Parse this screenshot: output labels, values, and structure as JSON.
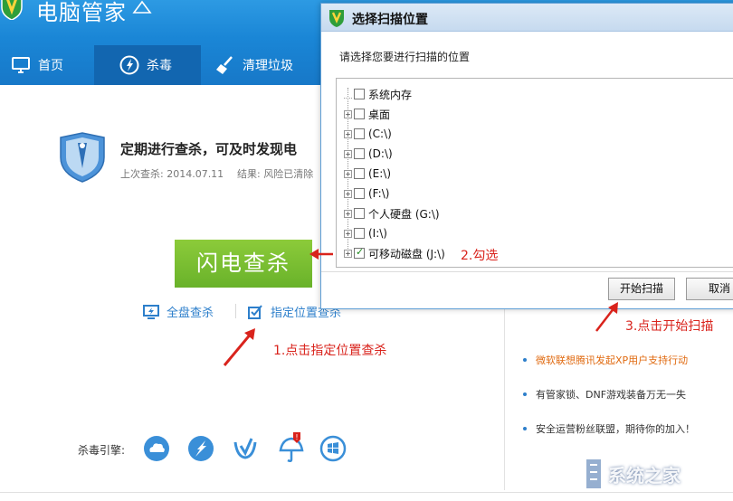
{
  "app": {
    "title": "电脑管家"
  },
  "nav": {
    "items": [
      {
        "label": "首页",
        "icon": "monitor-icon"
      },
      {
        "label": "杀毒",
        "icon": "lightning-icon"
      },
      {
        "label": "清理垃圾",
        "icon": "broom-icon"
      }
    ]
  },
  "main": {
    "heading": "定期进行查杀，可及时发现电",
    "last_scan": "上次查杀: 2014.07.11",
    "result": "结果: 风险已清除",
    "flash_button": "闪电查杀",
    "full_scan": "全盘查杀",
    "custom_scan": "指定位置查杀",
    "engine_label": "杀毒引擎:",
    "engines": [
      "cloud-engine-icon",
      "system-repair-engine-icon",
      "heuristic-engine-icon",
      "umbrella-engine-icon",
      "windows-engine-icon"
    ]
  },
  "news": [
    "微软联想腾讯发起XP用户支持行动",
    "有管家锁、DNF游戏装备万无一失",
    "安全运营粉丝联盟，期待你的加入！"
  ],
  "dialog": {
    "title": "选择扫描位置",
    "prompt": "请选择您要进行扫描的位置",
    "tree": [
      {
        "label": "系统内存",
        "expandable": false,
        "checked": false
      },
      {
        "label": "桌面",
        "expandable": true,
        "checked": false
      },
      {
        "label": "(C:\\)",
        "expandable": true,
        "checked": false
      },
      {
        "label": "(D:\\)",
        "expandable": true,
        "checked": false
      },
      {
        "label": "(E:\\)",
        "expandable": true,
        "checked": false
      },
      {
        "label": "(F:\\)",
        "expandable": true,
        "checked": false
      },
      {
        "label": "个人硬盘 (G:\\)",
        "expandable": true,
        "checked": false
      },
      {
        "label": "(I:\\)",
        "expandable": true,
        "checked": false
      },
      {
        "label": "可移动磁盘 (J:\\)",
        "expandable": true,
        "checked": true
      }
    ],
    "start_button": "开始扫描",
    "cancel_button": "取消"
  },
  "annotations": {
    "step1": "1.点击指定位置查杀",
    "step2": "2.勾选",
    "step3": "3.点击开始扫描"
  },
  "watermark": "系统之家",
  "colors": {
    "header_blue": "#1a86d6",
    "active_tab": "#1266b0",
    "flash_green": "#78bd30",
    "link_blue": "#2d7fcb",
    "annotation_red": "#d9231c"
  }
}
